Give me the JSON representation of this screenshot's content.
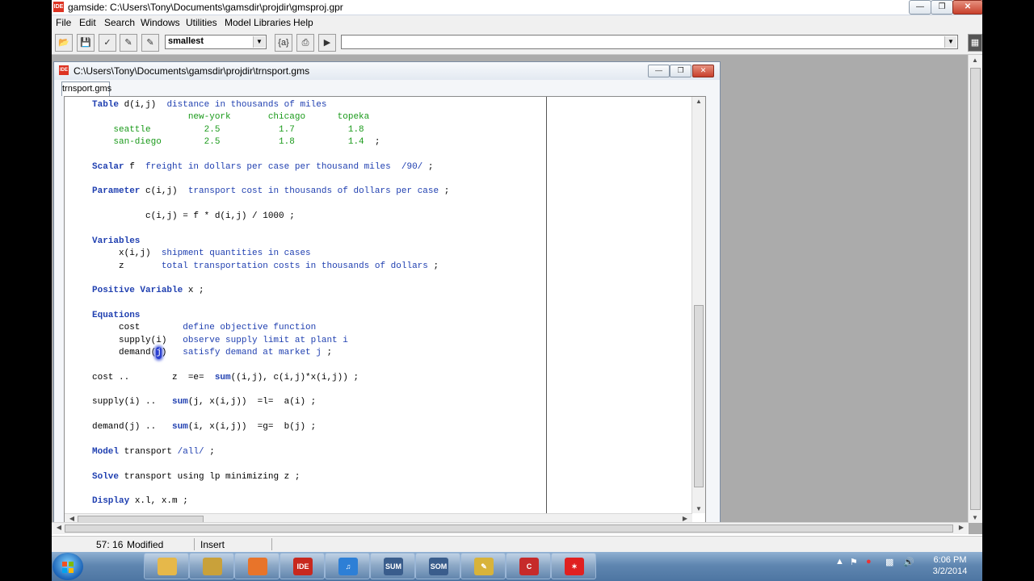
{
  "window": {
    "title": "gamside: C:\\Users\\Tony\\Documents\\gamsdir\\projdir\\gmsproj.gpr",
    "app_icon": "IDE"
  },
  "menu": [
    "File",
    "Edit",
    "Search",
    "Windows",
    "Utilities",
    "Model Libraries",
    "Help"
  ],
  "toolbar": {
    "combo_value": "smallest",
    "param_button": "{a}",
    "command_value": ""
  },
  "child": {
    "title": "C:\\Users\\Tony\\Documents\\gamsdir\\projdir\\trnsport.gms",
    "tab": "trnsport.gms"
  },
  "code": [
    [
      {
        "c": "kw",
        "t": "Table"
      },
      {
        "c": "",
        "t": " d(i,j)  "
      },
      {
        "c": "tx",
        "t": "distance in thousands of miles"
      }
    ],
    [
      {
        "c": "nm",
        "t": "                  new-york       chicago      topeka"
      }
    ],
    [
      {
        "c": "nm",
        "t": "    seattle          2.5           1.7          1.8"
      }
    ],
    [
      {
        "c": "nm",
        "t": "    san-diego        2.5           1.8          1.4"
      },
      {
        "c": "",
        "t": "  ;"
      }
    ],
    [],
    [
      {
        "c": "kw",
        "t": "Scalar"
      },
      {
        "c": "",
        "t": " f  "
      },
      {
        "c": "tx",
        "t": "freight in dollars per case per thousand miles  /90/"
      },
      {
        "c": "",
        "t": " ;"
      }
    ],
    [],
    [
      {
        "c": "kw",
        "t": "Parameter"
      },
      {
        "c": "",
        "t": " c(i,j)  "
      },
      {
        "c": "tx",
        "t": "transport cost in thousands of dollars per case"
      },
      {
        "c": "",
        "t": " ;"
      }
    ],
    [],
    [
      {
        "c": "",
        "t": "          c(i,j) = f * d(i,j) / 1000 ;"
      }
    ],
    [],
    [
      {
        "c": "kw",
        "t": "Variables"
      }
    ],
    [
      {
        "c": "",
        "t": "     x(i,j)  "
      },
      {
        "c": "tx",
        "t": "shipment quantities in cases"
      }
    ],
    [
      {
        "c": "",
        "t": "     z       "
      },
      {
        "c": "tx",
        "t": "total transportation costs in thousands of dollars"
      },
      {
        "c": "",
        "t": " ;"
      }
    ],
    [],
    [
      {
        "c": "kw",
        "t": "Positive Variable"
      },
      {
        "c": "",
        "t": " x ;"
      }
    ],
    [],
    [
      {
        "c": "kw",
        "t": "Equations"
      }
    ],
    [
      {
        "c": "",
        "t": "     cost        "
      },
      {
        "c": "tx",
        "t": "define objective function"
      }
    ],
    [
      {
        "c": "",
        "t": "     supply(i)   "
      },
      {
        "c": "tx",
        "t": "observe supply limit at plant i"
      }
    ],
    [
      {
        "c": "",
        "t": "     demand("
      },
      {
        "c": "cursorhl",
        "t": "j"
      },
      {
        "c": "",
        "t": ")   "
      },
      {
        "c": "tx",
        "t": "satisfy demand at market j"
      },
      {
        "c": "",
        "t": " ;"
      }
    ],
    [],
    [
      {
        "c": "",
        "t": "cost ..        z  =e=  "
      },
      {
        "c": "kw",
        "t": "sum"
      },
      {
        "c": "",
        "t": "((i,j), c(i,j)*x(i,j)) ;"
      }
    ],
    [],
    [
      {
        "c": "",
        "t": "supply(i) ..   "
      },
      {
        "c": "kw",
        "t": "sum"
      },
      {
        "c": "",
        "t": "(j, x(i,j))  =l=  a(i) ;"
      }
    ],
    [],
    [
      {
        "c": "",
        "t": "demand(j) ..   "
      },
      {
        "c": "kw",
        "t": "sum"
      },
      {
        "c": "",
        "t": "(i, x(i,j))  =g=  b(j) ;"
      }
    ],
    [],
    [
      {
        "c": "kw",
        "t": "Model"
      },
      {
        "c": "",
        "t": " transport "
      },
      {
        "c": "tx",
        "t": "/all/"
      },
      {
        "c": "",
        "t": " ;"
      }
    ],
    [],
    [
      {
        "c": "kw",
        "t": "Solve"
      },
      {
        "c": "",
        "t": " transport using lp minimizing z ;"
      }
    ],
    [],
    [
      {
        "c": "kw",
        "t": "Display"
      },
      {
        "c": "",
        "t": " x.l, x.m ;"
      }
    ]
  ],
  "status": {
    "position": "57: 16",
    "modified": "Modified",
    "mode": "Insert"
  },
  "taskbar": {
    "apps": [
      {
        "icon": "explorer-icon",
        "label": "",
        "color": "#e6b84a"
      },
      {
        "icon": "files-icon",
        "label": "",
        "color": "#c9a13a"
      },
      {
        "icon": "firefox-icon",
        "label": "",
        "color": "#e8742a"
      },
      {
        "icon": "gams-ide-icon",
        "label": "IDE",
        "color": "#c8281e"
      },
      {
        "icon": "music-icon",
        "label": "♫",
        "color": "#2d7fd6"
      },
      {
        "icon": "sum-icon",
        "label": "SUM",
        "color": "#3a5d8c"
      },
      {
        "icon": "som-icon",
        "label": "SOM",
        "color": "#3a5d8c"
      },
      {
        "icon": "tool-icon",
        "label": "✎",
        "color": "#d8b33a"
      },
      {
        "icon": "app-c-icon",
        "label": "C",
        "color": "#c62a2a"
      },
      {
        "icon": "splat-icon",
        "label": "✶",
        "color": "#e02020"
      }
    ],
    "time": "6:06 PM",
    "date": "3/2/2014"
  }
}
